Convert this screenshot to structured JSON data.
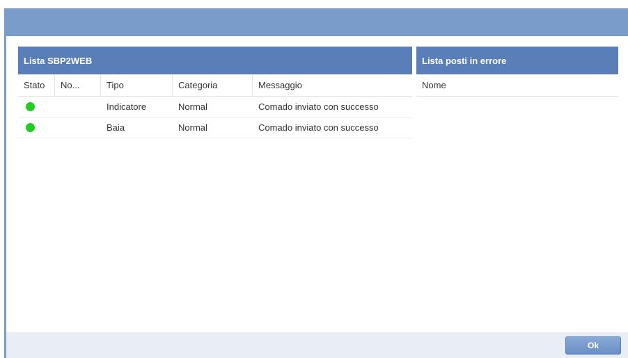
{
  "left_panel": {
    "title": "Lista SBP2WEB",
    "columns": [
      "Stato",
      "No...",
      "Tipo",
      "Categoria",
      "Messaggio"
    ],
    "rows": [
      {
        "status_color": "#22cc22",
        "nome": "",
        "tipo": "Indicatore",
        "categoria": "Normal",
        "messaggio": "Comado inviato con successo"
      },
      {
        "status_color": "#22cc22",
        "nome": "",
        "tipo": "Baia",
        "categoria": "Normal",
        "messaggio": "Comado inviato con successo"
      }
    ]
  },
  "right_panel": {
    "title": "Lista posti in errore",
    "columns": [
      "Nome"
    ]
  },
  "footer": {
    "ok_label": "Ok"
  },
  "colors": {
    "titlebar": "#7a9ccb",
    "panel_header": "#5a7fb8",
    "status_ok": "#22cc22"
  }
}
